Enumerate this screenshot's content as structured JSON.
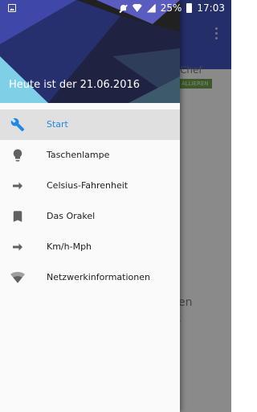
{
  "status_bar": {
    "battery_percent": "25%",
    "time": "17:03",
    "icons": [
      "image-icon",
      "mute-icon",
      "wifi-icon",
      "signal-icon",
      "battery-icon"
    ]
  },
  "background_app": {
    "card_title": "Chef",
    "card_badge": "ALLIEREN",
    "text_1": "en",
    "text_2": "-"
  },
  "drawer": {
    "header_text": "Heute ist der 21.06.2016",
    "items": [
      {
        "label": "Start",
        "icon": "wrench-icon",
        "active": true
      },
      {
        "label": "Taschenlampe",
        "icon": "lightbulb-icon",
        "active": false
      },
      {
        "label": "Celsius-Fahrenheit",
        "icon": "arrow-right-icon",
        "active": false
      },
      {
        "label": "Das Orakel",
        "icon": "bookmark-icon",
        "active": false
      },
      {
        "label": "Km/h-Mph",
        "icon": "arrow-right-icon",
        "active": false
      },
      {
        "label": "Netzwerkinformationen",
        "icon": "wifi-icon",
        "active": false
      }
    ]
  },
  "colors": {
    "accent": "#1e88e5",
    "active_bg": "#e0e0e0",
    "toolbar": "#3f51b5",
    "icon": "#616161"
  }
}
